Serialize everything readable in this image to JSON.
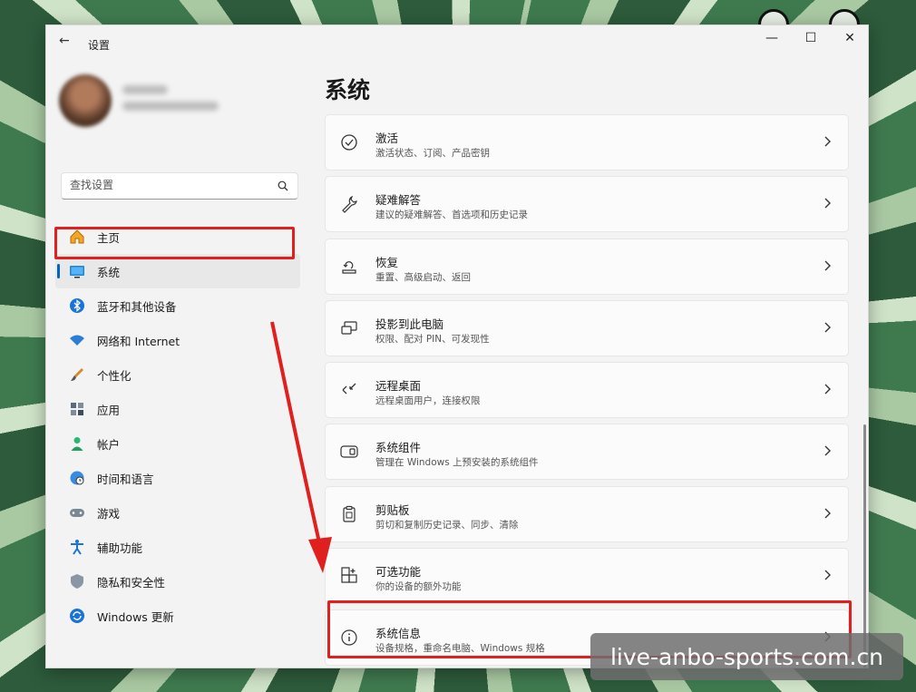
{
  "window": {
    "title": "设置",
    "back_icon": "back-arrow-icon",
    "controls": {
      "minimize": "—",
      "maximize": "☐",
      "close": "✕"
    }
  },
  "search": {
    "placeholder": "查找设置",
    "icon": "search-icon"
  },
  "sidebar": {
    "items": [
      {
        "label": "主页",
        "icon": "home-icon",
        "active": false
      },
      {
        "label": "系统",
        "icon": "monitor-icon",
        "active": true
      },
      {
        "label": "蓝牙和其他设备",
        "icon": "bluetooth-icon",
        "active": false
      },
      {
        "label": "网络和 Internet",
        "icon": "wifi-icon",
        "active": false
      },
      {
        "label": "个性化",
        "icon": "brush-icon",
        "active": false
      },
      {
        "label": "应用",
        "icon": "apps-icon",
        "active": false
      },
      {
        "label": "帐户",
        "icon": "person-icon",
        "active": false
      },
      {
        "label": "时间和语言",
        "icon": "globe-clock-icon",
        "active": false
      },
      {
        "label": "游戏",
        "icon": "gamepad-icon",
        "active": false
      },
      {
        "label": "辅助功能",
        "icon": "accessibility-icon",
        "active": false
      },
      {
        "label": "隐私和安全性",
        "icon": "shield-icon",
        "active": false
      },
      {
        "label": "Windows 更新",
        "icon": "update-icon",
        "active": false
      }
    ]
  },
  "main": {
    "page_title": "系统",
    "cards": [
      {
        "title": "激活",
        "subtitle": "激活状态、订阅、产品密钥",
        "icon": "check-circle-icon"
      },
      {
        "title": "疑难解答",
        "subtitle": "建议的疑难解答、首选项和历史记录",
        "icon": "wrench-icon"
      },
      {
        "title": "恢复",
        "subtitle": "重置、高级启动、返回",
        "icon": "recovery-icon"
      },
      {
        "title": "投影到此电脑",
        "subtitle": "权限、配对 PIN、可发现性",
        "icon": "project-icon"
      },
      {
        "title": "远程桌面",
        "subtitle": "远程桌面用户，连接权限",
        "icon": "remote-desktop-icon"
      },
      {
        "title": "系统组件",
        "subtitle": "管理在 Windows 上预安装的系统组件",
        "icon": "components-icon"
      },
      {
        "title": "剪贴板",
        "subtitle": "剪切和复制历史记录、同步、清除",
        "icon": "clipboard-icon"
      },
      {
        "title": "可选功能",
        "subtitle": "你的设备的额外功能",
        "icon": "add-feature-icon"
      },
      {
        "title": "系统信息",
        "subtitle": "设备规格，重命名电脑、Windows 规格",
        "icon": "info-icon"
      }
    ]
  },
  "watermark": {
    "text": "live-anbo-sports.com.cn"
  },
  "colors": {
    "accent": "#0067c0",
    "highlight": "#e0201e",
    "window_bg": "#f3f3f3",
    "card_bg": "#fbfbfb"
  }
}
